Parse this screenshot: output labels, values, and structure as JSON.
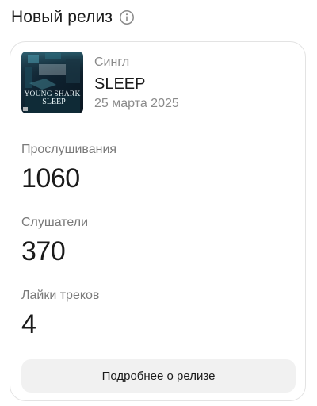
{
  "header": {
    "title": "Новый релиз",
    "info_icon": "info-circle-icon"
  },
  "release": {
    "cover_text_line1": "YOUNG SHARK",
    "cover_text_line2": "SLEEP",
    "type": "Сингл",
    "title": "SLEEP",
    "date": "25 марта 2025"
  },
  "stats": [
    {
      "label": "Прослушивания",
      "value": "1060"
    },
    {
      "label": "Слушатели",
      "value": "370"
    },
    {
      "label": "Лайки треков",
      "value": "4"
    }
  ],
  "actions": {
    "details_label": "Подробнее о релизе"
  },
  "colors": {
    "text_primary": "#1a1a1a",
    "text_secondary": "#8a8a8a",
    "button_bg": "#f1f1f1",
    "card_border": "#e3e3e3"
  }
}
